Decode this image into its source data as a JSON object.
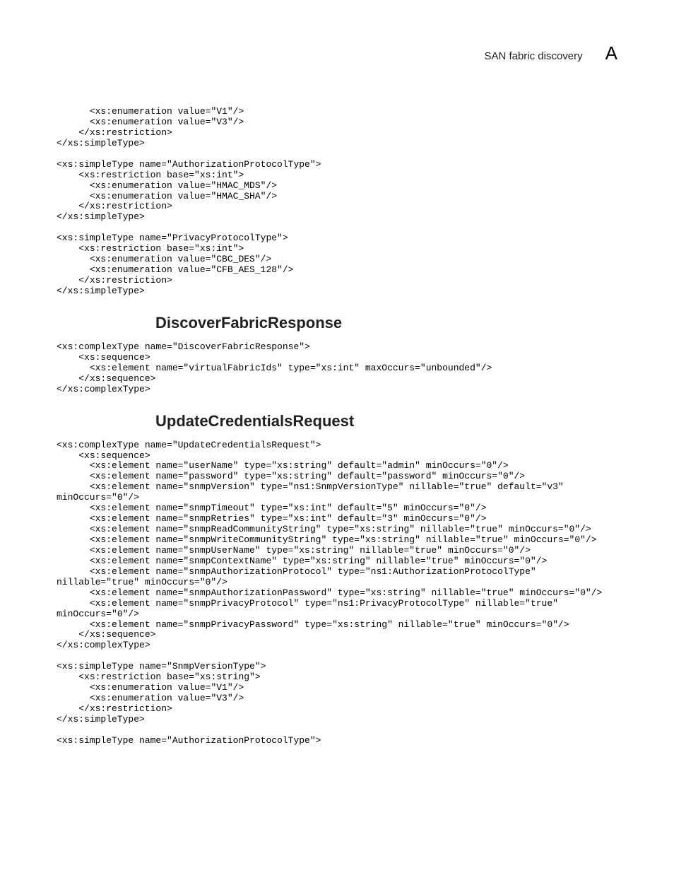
{
  "header": {
    "section": "SAN fabric discovery",
    "appendix": "A"
  },
  "code_block_1": "      <xs:enumeration value=\"V1\"/>\n      <xs:enumeration value=\"V3\"/>\n    </xs:restriction>\n</xs:simpleType>\n\n<xs:simpleType name=\"AuthorizationProtocolType\">\n    <xs:restriction base=\"xs:int\">\n      <xs:enumeration value=\"HMAC_MDS\"/>\n      <xs:enumeration value=\"HMAC_SHA\"/>\n    </xs:restriction>\n</xs:simpleType>\n\n<xs:simpleType name=\"PrivacyProtocolType\">\n    <xs:restriction base=\"xs:int\">\n      <xs:enumeration value=\"CBC_DES\"/>\n      <xs:enumeration value=\"CFB_AES_128\"/>\n    </xs:restriction>\n</xs:simpleType>",
  "heading_1": "DiscoverFabricResponse",
  "code_block_2": "<xs:complexType name=\"DiscoverFabricResponse\">\n    <xs:sequence>\n      <xs:element name=\"virtualFabricIds\" type=\"xs:int\" maxOccurs=\"unbounded\"/>\n    </xs:sequence>\n</xs:complexType>",
  "heading_2": "UpdateCredentialsRequest",
  "code_block_3": "<xs:complexType name=\"UpdateCredentialsRequest\">\n    <xs:sequence>\n      <xs:element name=\"userName\" type=\"xs:string\" default=\"admin\" minOccurs=\"0\"/>\n      <xs:element name=\"password\" type=\"xs:string\" default=\"password\" minOccurs=\"0\"/>\n      <xs:element name=\"snmpVersion\" type=\"ns1:SnmpVersionType\" nillable=\"true\" default=\"v3\" minOccurs=\"0\"/>\n      <xs:element name=\"snmpTimeout\" type=\"xs:int\" default=\"5\" minOccurs=\"0\"/>\n      <xs:element name=\"snmpRetries\" type=\"xs:int\" default=\"3\" minOccurs=\"0\"/>\n      <xs:element name=\"snmpReadCommunityString\" type=\"xs:string\" nillable=\"true\" minOccurs=\"0\"/>\n      <xs:element name=\"snmpWriteCommunityString\" type=\"xs:string\" nillable=\"true\" minOccurs=\"0\"/>\n      <xs:element name=\"snmpUserName\" type=\"xs:string\" nillable=\"true\" minOccurs=\"0\"/>\n      <xs:element name=\"snmpContextName\" type=\"xs:string\" nillable=\"true\" minOccurs=\"0\"/>\n      <xs:element name=\"snmpAuthorizationProtocol\" type=\"ns1:AuthorizationProtocolType\" nillable=\"true\" minOccurs=\"0\"/>\n      <xs:element name=\"snmpAuthorizationPassword\" type=\"xs:string\" nillable=\"true\" minOccurs=\"0\"/>\n      <xs:element name=\"snmpPrivacyProtocol\" type=\"ns1:PrivacyProtocolType\" nillable=\"true\" minOccurs=\"0\"/>\n      <xs:element name=\"snmpPrivacyPassword\" type=\"xs:string\" nillable=\"true\" minOccurs=\"0\"/>\n    </xs:sequence>\n</xs:complexType>\n\n<xs:simpleType name=\"SnmpVersionType\">\n    <xs:restriction base=\"xs:string\">\n      <xs:enumeration value=\"V1\"/>\n      <xs:enumeration value=\"V3\"/>\n    </xs:restriction>\n</xs:simpleType>\n\n<xs:simpleType name=\"AuthorizationProtocolType\">"
}
